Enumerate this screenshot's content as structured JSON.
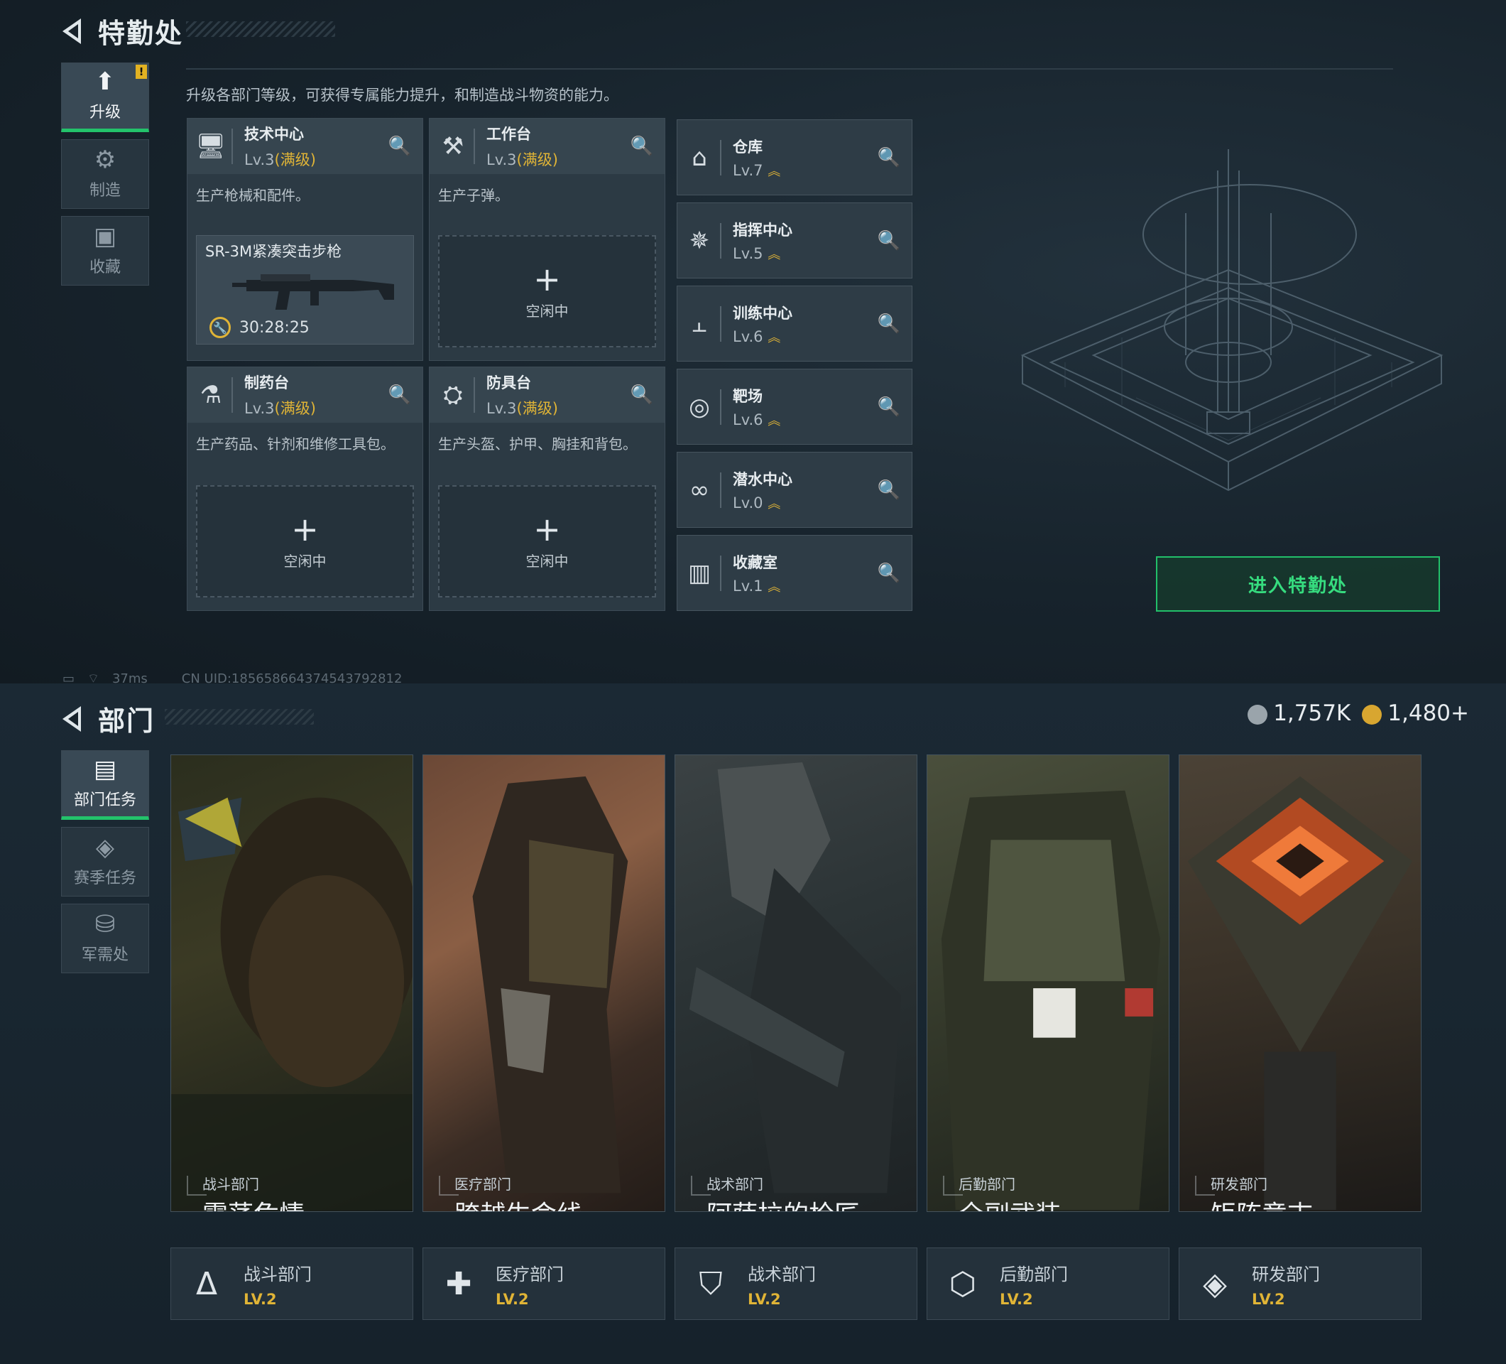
{
  "upper": {
    "title": "特勤处",
    "tabs": [
      {
        "label": "升级",
        "icon": "upgrade-icon",
        "active": true
      },
      {
        "label": "制造",
        "icon": "gear-icon",
        "active": false
      },
      {
        "label": "收藏",
        "icon": "collection-icon",
        "active": false
      }
    ],
    "description": "升级各部门等级，可获得专属能力提升，和制造战斗物资的能力。",
    "cards": [
      {
        "name": "技术中心",
        "level": "Lv.3",
        "maxed": "(满级)",
        "desc": "生产枪械和配件。",
        "product": "SR-3M紧凑突击步枪",
        "timer": "30:28:25"
      },
      {
        "name": "工作台",
        "level": "Lv.3",
        "maxed": "(满级)",
        "desc": "生产子弹。",
        "idle": "空闲中"
      },
      {
        "name": "制药台",
        "level": "Lv.3",
        "maxed": "(满级)",
        "desc": "生产药品、针剂和维修工具包。",
        "idle": "空闲中"
      },
      {
        "name": "防具台",
        "level": "Lv.3",
        "maxed": "(满级)",
        "desc": "生产头盔、护甲、胸挂和背包。",
        "idle": "空闲中"
      }
    ],
    "facilities": [
      {
        "name": "仓库",
        "level": "Lv.7",
        "icon": "warehouse-icon"
      },
      {
        "name": "指挥中心",
        "level": "Lv.5",
        "icon": "command-icon"
      },
      {
        "name": "训练中心",
        "level": "Lv.6",
        "icon": "dumbbell-icon"
      },
      {
        "name": "靶场",
        "level": "Lv.6",
        "icon": "target-icon"
      },
      {
        "name": "潜水中心",
        "level": "Lv.0",
        "icon": "diving-icon"
      },
      {
        "name": "收藏室",
        "level": "Lv.1",
        "icon": "vault-icon"
      }
    ],
    "enter_button": "进入特勤处",
    "status": {
      "ping": "37ms",
      "uid": "CN UID:185658664374543792812"
    }
  },
  "lower": {
    "title": "部门",
    "currency": [
      {
        "value": "1,757K",
        "color": "#9aa4ab"
      },
      {
        "value": "1,480+",
        "color": "#d8a630"
      }
    ],
    "tabs": [
      {
        "label": "部门任务",
        "icon": "dept-task-icon",
        "active": true
      },
      {
        "label": "赛季任务",
        "icon": "season-task-icon",
        "active": false
      },
      {
        "label": "军需处",
        "icon": "supply-icon",
        "active": false
      }
    ],
    "departments": [
      {
        "category": "战斗部门",
        "title": "震荡危情",
        "foot": "战斗部门",
        "level": "LV.2",
        "icon": "combat-icon",
        "tint": "#3a3a22"
      },
      {
        "category": "医疗部门",
        "title": "跨越生命线",
        "foot": "医疗部门",
        "level": "LV.2",
        "icon": "medical-cross-icon",
        "tint": "#6a4530"
      },
      {
        "category": "战术部门",
        "title": "阿萨拉的枪匠",
        "foot": "战术部门",
        "level": "LV.2",
        "icon": "tactical-shield-icon",
        "tint": "#30383a"
      },
      {
        "category": "后勤部门",
        "title": "全副武装",
        "foot": "后勤部门",
        "level": "LV.2",
        "icon": "logistics-icon",
        "tint": "#3a4030"
      },
      {
        "category": "研发部门",
        "title": "矩阵意志",
        "foot": "研发部门",
        "level": "LV.2",
        "icon": "research-icon",
        "tint": "#4a3020"
      }
    ]
  }
}
